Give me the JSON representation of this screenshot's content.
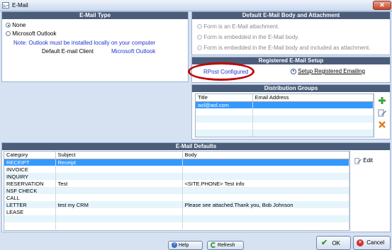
{
  "window": {
    "title": "E-Mail",
    "close_glyph": "✕"
  },
  "email_type": {
    "header": "E-Mail Type",
    "options": [
      "None",
      "Microsoft Outlook"
    ],
    "selected": "None",
    "note": "Note: Outlook must be installed locally on your computer",
    "default_client_label": "Default E-mail Client",
    "default_client_value": "Microsoft Outlook"
  },
  "body_attachment": {
    "header": "Default E-Mail Body and Attachment",
    "options": [
      "Form is an E-Mail attachment.",
      "Form is embedded in the E-Mail body.",
      "Form is embedded in the E-Mail body and included as attachment."
    ]
  },
  "registered_setup": {
    "header": "Registered E-Mail Setup",
    "status": "RPost Configured",
    "setup_link": "Setup Registered Emailing"
  },
  "distribution_groups": {
    "header": "Distribution Groups",
    "columns": [
      "Title",
      "Email Address"
    ],
    "rows": [
      {
        "title": "aol@aol.com",
        "email": ""
      }
    ],
    "actions": [
      "add-icon",
      "edit-icon",
      "delete-icon"
    ]
  },
  "email_defaults": {
    "header": "E-Mail Defaults",
    "columns": [
      "Category",
      "Subject",
      "Body"
    ],
    "rows": [
      {
        "category": "RECEIPT",
        "subject": "Receipt",
        "body": ""
      },
      {
        "category": "INVOICE",
        "subject": "",
        "body": ""
      },
      {
        "category": "INQUIRY",
        "subject": "",
        "body": ""
      },
      {
        "category": "RESERVATION",
        "subject": "Test",
        "body": "<SITE.PHONE> Test info"
      },
      {
        "category": "NSF CHECK",
        "subject": "",
        "body": ""
      },
      {
        "category": "CALL",
        "subject": "",
        "body": ""
      },
      {
        "category": "LETTER",
        "subject": "test my CRM",
        "body": "Please see attached.Thank you, Bob Johnson"
      },
      {
        "category": "LEASE",
        "subject": "",
        "body": ""
      }
    ],
    "edit_label": "Edit"
  },
  "footer": {
    "help": "Help",
    "refresh": "Refresh",
    "ok": "OK",
    "cancel": "Cancel"
  },
  "colors": {
    "header_bg": "#4b5d79",
    "selection": "#3399ff",
    "link": "#2233cc",
    "highlight_ring": "#c00000"
  }
}
